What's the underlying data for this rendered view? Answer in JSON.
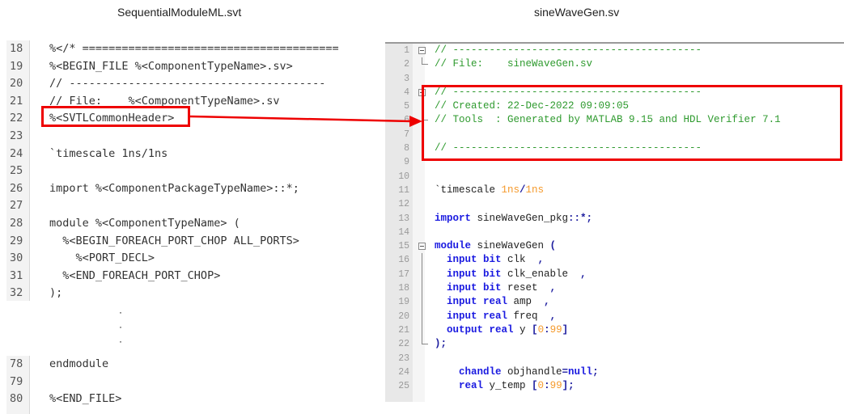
{
  "captions": {
    "left": "SequentialModuleML.svt",
    "right": "sineWaveGen.sv"
  },
  "left_editor": {
    "top_lines": [
      {
        "n": "18",
        "text": "%</* ======================================="
      },
      {
        "n": "19",
        "text": "%<BEGIN_FILE %<ComponentTypeName>.sv>"
      },
      {
        "n": "20",
        "text": "// ---------------------------------------"
      },
      {
        "n": "21",
        "text": "// File:    %<ComponentTypeName>.sv"
      },
      {
        "n": "22",
        "text": "%<SVTLCommonHeader>"
      },
      {
        "n": "23",
        "text": ""
      },
      {
        "n": "24",
        "text": "`timescale 1ns/1ns"
      },
      {
        "n": "25",
        "text": ""
      },
      {
        "n": "26",
        "text": "import %<ComponentPackageTypeName>::*;"
      },
      {
        "n": "27",
        "text": ""
      },
      {
        "n": "28",
        "text": "module %<ComponentTypeName> ("
      },
      {
        "n": "29",
        "text": "  %<BEGIN_FOREACH_PORT_CHOP ALL_PORTS>"
      },
      {
        "n": "30",
        "text": "    %<PORT_DECL>"
      },
      {
        "n": "31",
        "text": "  %<END_FOREACH_PORT_CHOP>"
      },
      {
        "n": "32",
        "text": ");"
      }
    ],
    "ellipsis": [
      "·",
      "·",
      "·"
    ],
    "bottom_lines": [
      {
        "n": "78",
        "text": "endmodule"
      },
      {
        "n": "79",
        "text": ""
      },
      {
        "n": "80",
        "text": "%<END_FILE>"
      }
    ]
  },
  "right_editor": {
    "lines": [
      {
        "n": "1",
        "fold": "start",
        "segments": [
          {
            "t": "// -----------------------------------------",
            "c": "comment"
          }
        ]
      },
      {
        "n": "2",
        "fold": "end",
        "segments": [
          {
            "t": "// File:    sineWaveGen.sv",
            "c": "comment"
          }
        ]
      },
      {
        "n": "3",
        "fold": "",
        "segments": []
      },
      {
        "n": "4",
        "fold": "start",
        "segments": [
          {
            "t": "// -----------------------------------------",
            "c": "comment"
          }
        ]
      },
      {
        "n": "5",
        "fold": "line",
        "segments": [
          {
            "t": "// Created: 22-Dec-2022 09:09:05",
            "c": "comment"
          }
        ]
      },
      {
        "n": "6",
        "fold": "end",
        "segments": [
          {
            "t": "// Tools  : Generated by MATLAB 9.15 and HDL Verifier 7.1",
            "c": "comment"
          }
        ]
      },
      {
        "n": "7",
        "fold": "",
        "segments": []
      },
      {
        "n": "8",
        "fold": "",
        "segments": [
          {
            "t": "// -----------------------------------------",
            "c": "comment"
          }
        ]
      },
      {
        "n": "9",
        "fold": "",
        "segments": []
      },
      {
        "n": "10",
        "fold": "",
        "segments": []
      },
      {
        "n": "11",
        "fold": "",
        "segments": [
          {
            "t": "`timescale ",
            "c": "plain"
          },
          {
            "t": "1ns",
            "c": "num"
          },
          {
            "t": "/",
            "c": "op"
          },
          {
            "t": "1ns",
            "c": "num"
          }
        ]
      },
      {
        "n": "12",
        "fold": "",
        "segments": []
      },
      {
        "n": "13",
        "fold": "",
        "segments": [
          {
            "t": "import",
            "c": "kw"
          },
          {
            "t": " sineWaveGen_pkg",
            "c": "plain"
          },
          {
            "t": "::*;",
            "c": "op"
          }
        ]
      },
      {
        "n": "14",
        "fold": "",
        "segments": []
      },
      {
        "n": "15",
        "fold": "start",
        "segments": [
          {
            "t": "module",
            "c": "kw"
          },
          {
            "t": " sineWaveGen ",
            "c": "plain"
          },
          {
            "t": "(",
            "c": "op"
          }
        ]
      },
      {
        "n": "16",
        "fold": "line",
        "segments": [
          {
            "t": "  input bit",
            "c": "kw"
          },
          {
            "t": " clk  ",
            "c": "plain"
          },
          {
            "t": ",",
            "c": "op"
          }
        ]
      },
      {
        "n": "17",
        "fold": "line",
        "segments": [
          {
            "t": "  input bit",
            "c": "kw"
          },
          {
            "t": " clk_enable  ",
            "c": "plain"
          },
          {
            "t": ",",
            "c": "op"
          }
        ]
      },
      {
        "n": "18",
        "fold": "line",
        "segments": [
          {
            "t": "  input bit",
            "c": "kw"
          },
          {
            "t": " reset  ",
            "c": "plain"
          },
          {
            "t": ",",
            "c": "op"
          }
        ]
      },
      {
        "n": "19",
        "fold": "line",
        "segments": [
          {
            "t": "  input real",
            "c": "kw"
          },
          {
            "t": " amp  ",
            "c": "plain"
          },
          {
            "t": ",",
            "c": "op"
          }
        ]
      },
      {
        "n": "20",
        "fold": "line",
        "segments": [
          {
            "t": "  input real",
            "c": "kw"
          },
          {
            "t": " freq  ",
            "c": "plain"
          },
          {
            "t": ",",
            "c": "op"
          }
        ]
      },
      {
        "n": "21",
        "fold": "line",
        "segments": [
          {
            "t": "  output real",
            "c": "kw"
          },
          {
            "t": " y ",
            "c": "plain"
          },
          {
            "t": "[",
            "c": "op"
          },
          {
            "t": "0",
            "c": "num"
          },
          {
            "t": ":",
            "c": "op"
          },
          {
            "t": "99",
            "c": "num"
          },
          {
            "t": "]",
            "c": "op"
          }
        ]
      },
      {
        "n": "22",
        "fold": "end",
        "segments": [
          {
            "t": ");",
            "c": "op"
          }
        ]
      },
      {
        "n": "23",
        "fold": "",
        "segments": []
      },
      {
        "n": "24",
        "fold": "",
        "segments": [
          {
            "t": "    chandle",
            "c": "kw"
          },
          {
            "t": " objhandle",
            "c": "plain"
          },
          {
            "t": "=",
            "c": "op"
          },
          {
            "t": "null",
            "c": "kw"
          },
          {
            "t": ";",
            "c": "op"
          }
        ]
      },
      {
        "n": "25",
        "fold": "",
        "segments": [
          {
            "t": "    real",
            "c": "kw"
          },
          {
            "t": " y_temp ",
            "c": "plain"
          },
          {
            "t": "[",
            "c": "op"
          },
          {
            "t": "0",
            "c": "num"
          },
          {
            "t": ":",
            "c": "op"
          },
          {
            "t": "99",
            "c": "num"
          },
          {
            "t": "];",
            "c": "op"
          }
        ]
      }
    ]
  },
  "highlight": {
    "color": "#ee0000",
    "source_token": "%<SVTLCommonHeader>",
    "target_description": "Generated common header lines 4-8"
  }
}
